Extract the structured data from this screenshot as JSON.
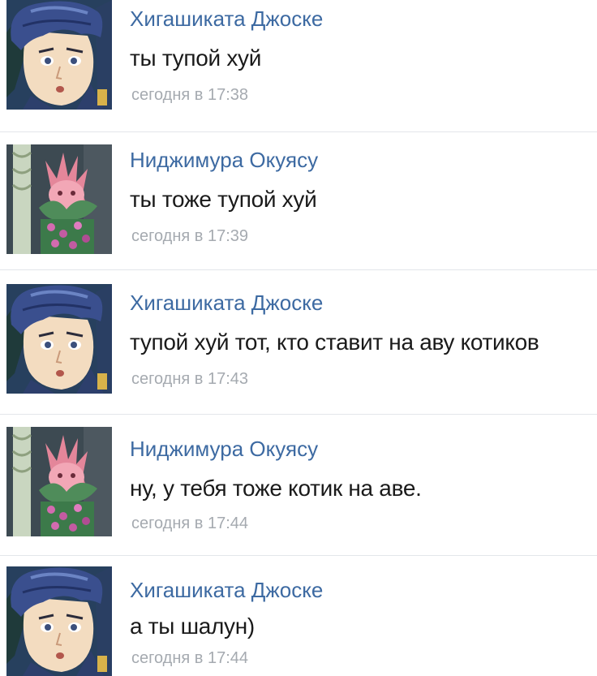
{
  "messages": [
    {
      "author": "Хигашиката Джоске",
      "text": "ты тупой хуй",
      "time": "сегодня в 17:38",
      "avatar": "josuke-avatar"
    },
    {
      "author": "Ниджимура Окуясу",
      "text": "ты тоже тупой хуй",
      "time": "сегодня в 17:39",
      "avatar": "cat-plant-avatar"
    },
    {
      "author": "Хигашиката Джоске",
      "text": "тупой хуй тот, кто ставит на аву котиков",
      "time": "сегодня в 17:43",
      "avatar": "josuke-avatar"
    },
    {
      "author": "Ниджимура Окуясу",
      "text": "ну, у тебя тоже котик на аве.",
      "time": "сегодня в 17:44",
      "avatar": "cat-plant-avatar"
    },
    {
      "author": "Хигашиката Джоске",
      "text": "а ты шалун)",
      "time": "сегодня в 17:44",
      "avatar": "josuke-avatar"
    }
  ],
  "colors": {
    "author": "#3d6aa2",
    "text": "#1a1a1a",
    "time": "#a5aab0",
    "divider": "#e3e6ea"
  }
}
